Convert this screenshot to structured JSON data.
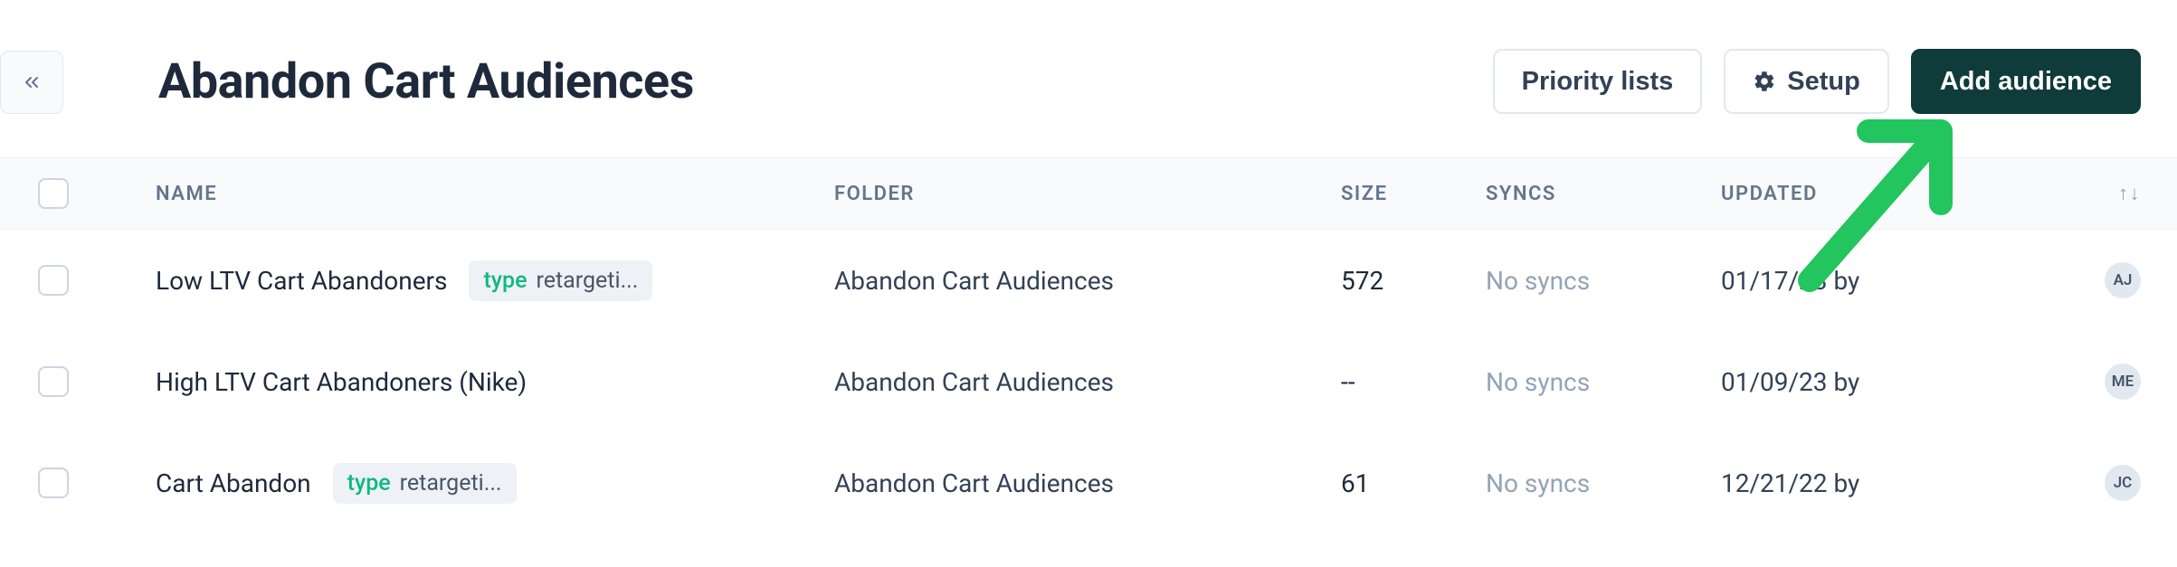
{
  "header": {
    "title": "Abandon Cart Audiences",
    "buttons": {
      "priority_lists": "Priority lists",
      "setup": "Setup",
      "add_audience": "Add audience"
    }
  },
  "table": {
    "columns": {
      "name": "NAME",
      "folder": "FOLDER",
      "size": "SIZE",
      "syncs": "SYNCS",
      "updated": "UPDATED"
    },
    "rows": [
      {
        "name": "Low LTV Cart Abandoners",
        "tag_key": "type",
        "tag_value": "retargeti...",
        "folder": "Abandon Cart Audiences",
        "size": "572",
        "syncs": "No syncs",
        "updated": "01/17/23 by",
        "avatar": "AJ"
      },
      {
        "name": "High LTV Cart Abandoners (Nike)",
        "tag_key": "",
        "tag_value": "",
        "folder": "Abandon Cart Audiences",
        "size": "--",
        "syncs": "No syncs",
        "updated": "01/09/23 by",
        "avatar": "ME"
      },
      {
        "name": "Cart Abandon",
        "tag_key": "type",
        "tag_value": "retargeti...",
        "folder": "Abandon Cart Audiences",
        "size": "61",
        "syncs": "No syncs",
        "updated": "12/21/22 by",
        "avatar": "JC"
      }
    ]
  }
}
